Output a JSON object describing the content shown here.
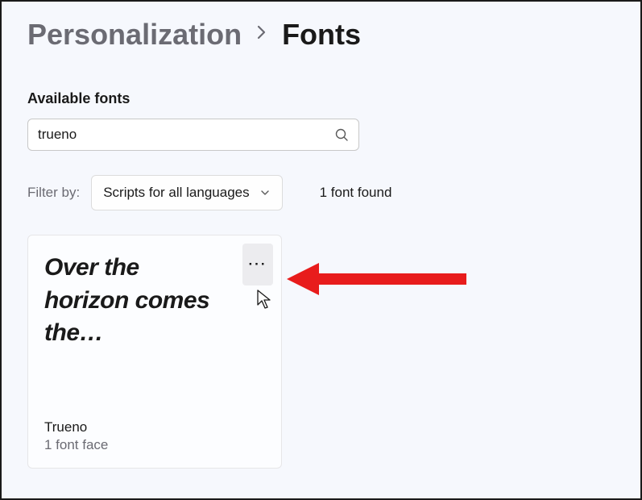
{
  "breadcrumb": {
    "parent": "Personalization",
    "current": "Fonts"
  },
  "section_title": "Available fonts",
  "search": {
    "value": "trueno"
  },
  "filter": {
    "label": "Filter by:",
    "selected": "Scripts for all languages"
  },
  "results_text": "1 font found",
  "font_card": {
    "preview": "Over the horizon comes the…",
    "name": "Trueno",
    "faces": "1 font face"
  }
}
